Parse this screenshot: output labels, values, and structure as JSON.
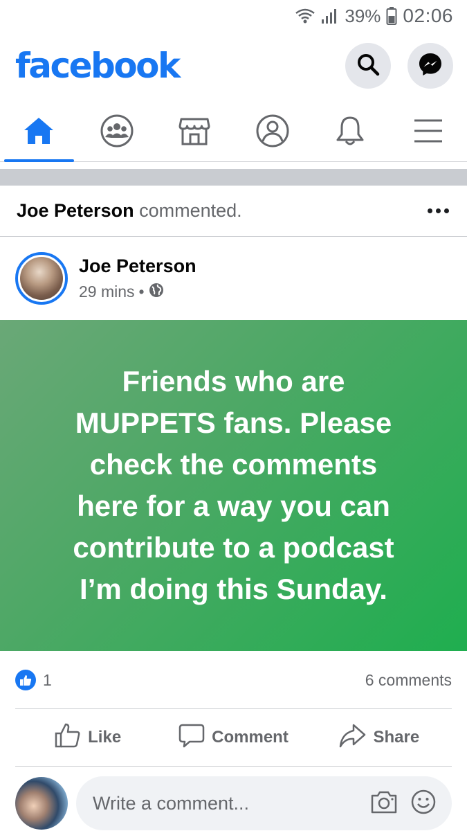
{
  "status_bar": {
    "battery": "39%",
    "time": "02:06",
    "wifi_icon": "wifi-icon",
    "signal_icon": "signal-icon",
    "battery_icon": "battery-icon"
  },
  "header": {
    "logo": "facebook",
    "search_icon": "search-icon",
    "messenger_icon": "messenger-icon"
  },
  "nav_tabs": [
    {
      "name": "home",
      "icon": "home-icon",
      "active": true
    },
    {
      "name": "groups",
      "icon": "groups-icon",
      "active": false
    },
    {
      "name": "marketplace",
      "icon": "marketplace-icon",
      "active": false
    },
    {
      "name": "profile",
      "icon": "profile-icon",
      "active": false
    },
    {
      "name": "notifications",
      "icon": "bell-icon",
      "active": false
    },
    {
      "name": "menu",
      "icon": "menu-icon",
      "active": false
    }
  ],
  "activity": {
    "actor": "Joe Peterson",
    "action": "commented."
  },
  "post": {
    "author": "Joe Peterson",
    "time": "29 mins",
    "separator": "•",
    "privacy_icon": "globe-icon",
    "text": "Friends who are MUPPETS fans. Please check the comments here for a way you can contribute to a podcast I’m doing this Sunday.",
    "text_lines": [
      "Friends who are",
      "MUPPETS fans. Please",
      "check the comments",
      "here for a way you can",
      "contribute to a podcast",
      "I’m doing this Sunday."
    ]
  },
  "reactions": {
    "like_count": "1",
    "comments": "6 comments"
  },
  "actions": {
    "like": "Like",
    "comment": "Comment",
    "share": "Share"
  },
  "composer": {
    "placeholder": "Write a comment..."
  },
  "colors": {
    "brand": "#1877f2",
    "banner_start": "#6aa877",
    "banner_end": "#1fae4f",
    "secondary_text": "#65676b"
  }
}
